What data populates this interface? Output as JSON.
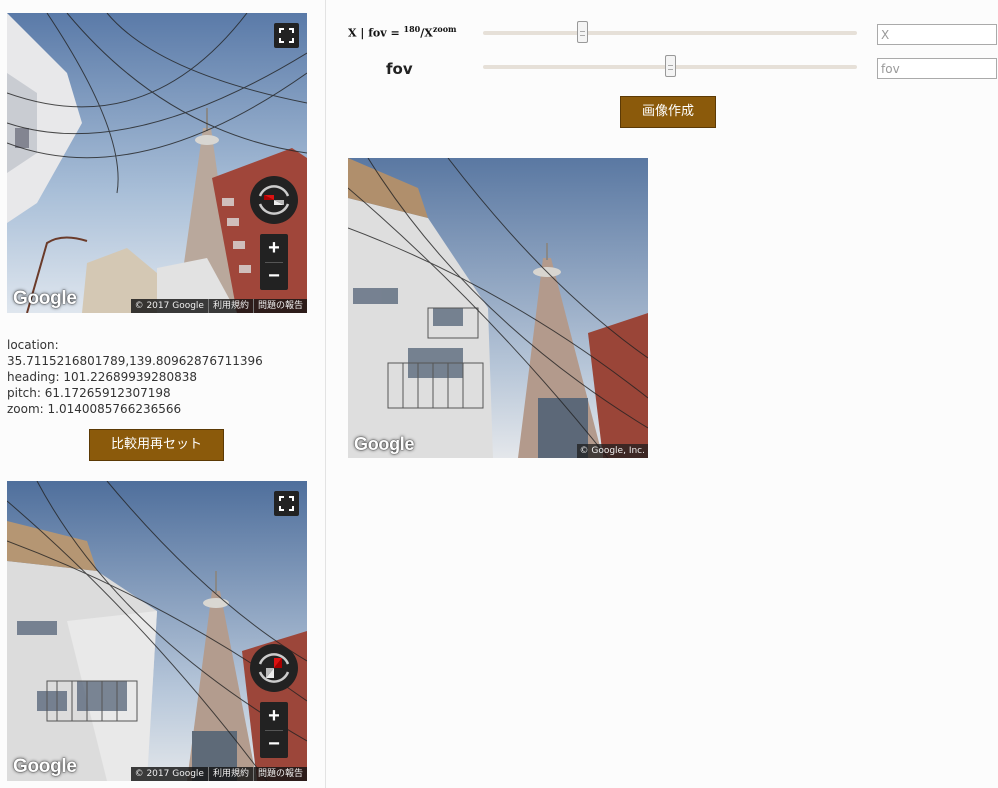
{
  "top_pano": {
    "logo": "Google",
    "attribution": [
      "© 2017 Google",
      "利用規約",
      "問題の報告"
    ],
    "zoom_in": "+",
    "zoom_out": "−"
  },
  "info": {
    "location_label": "location:",
    "location_value": "35.7115216801789,139.80962876711396",
    "heading": "heading: 101.22689939280838",
    "pitch": "pitch: 61.17265912307198",
    "zoom": "zoom: 1.0140085766236566"
  },
  "reset_button": "比較用再セット",
  "bottom_pano": {
    "logo": "Google",
    "attribution": [
      "© 2017 Google",
      "利用規約",
      "問題の報告"
    ],
    "zoom_in": "+",
    "zoom_out": "−"
  },
  "controls": {
    "x_label_prefix": "X | fov = ",
    "x_label_num": "180",
    "x_label_slash": "/",
    "x_label_base": "X",
    "x_label_exp": "zoom",
    "fov_label": "fov",
    "x_slider_value": 0.26,
    "fov_slider_value": 0.5,
    "x_placeholder": "X",
    "fov_placeholder": "fov",
    "create_button": "画像作成"
  },
  "static_image": {
    "logo": "Google",
    "attribution": "© Google, Inc."
  }
}
